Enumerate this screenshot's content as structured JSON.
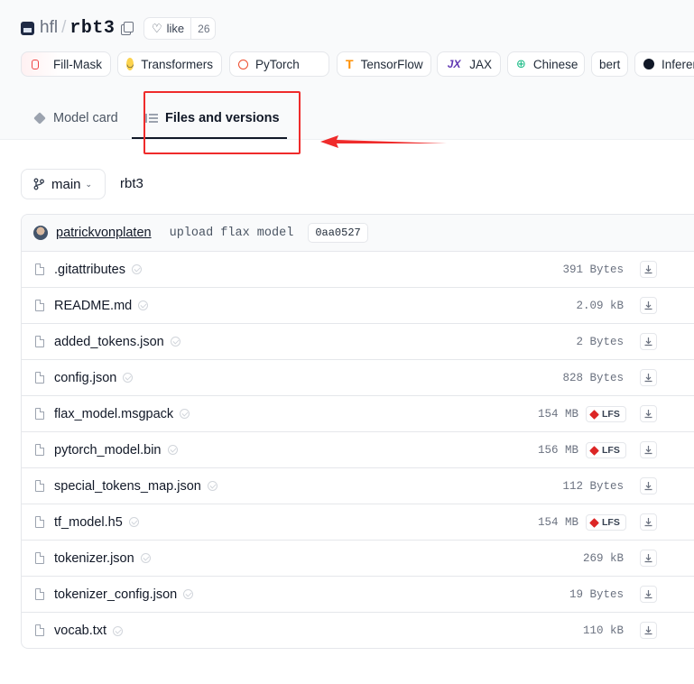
{
  "repo": {
    "org": "hfl",
    "name": "rbt3",
    "like_label": "like",
    "like_count": "26"
  },
  "tags": [
    {
      "label": "Fill-Mask",
      "icon": "fill-mask-icon"
    },
    {
      "label": "Transformers",
      "icon": "hugging-face-icon"
    },
    {
      "label": "PyTorch",
      "icon": "pytorch-icon"
    },
    {
      "label": "TensorFlow",
      "icon": "tensorflow-icon"
    },
    {
      "label": "JAX",
      "icon": "jax-icon"
    },
    {
      "label": "Chinese",
      "icon": "globe-icon"
    },
    {
      "label": "bert",
      "icon": ""
    },
    {
      "label": "Inference",
      "icon": "inference-icon"
    }
  ],
  "tabs": {
    "model_card": "Model card",
    "files": "Files and versions"
  },
  "branch": {
    "label": "main",
    "path": "rbt3"
  },
  "commit": {
    "author": "patrickvonplaten",
    "message": "upload flax model",
    "hash": "0aa0527"
  },
  "files": [
    {
      "name": ".gitattributes",
      "size": "391 Bytes",
      "lfs": false
    },
    {
      "name": "README.md",
      "size": "2.09 kB",
      "lfs": false
    },
    {
      "name": "added_tokens.json",
      "size": "2 Bytes",
      "lfs": false
    },
    {
      "name": "config.json",
      "size": "828 Bytes",
      "lfs": false
    },
    {
      "name": "flax_model.msgpack",
      "size": "154 MB",
      "lfs": true
    },
    {
      "name": "pytorch_model.bin",
      "size": "156 MB",
      "lfs": true
    },
    {
      "name": "special_tokens_map.json",
      "size": "112 Bytes",
      "lfs": false
    },
    {
      "name": "tf_model.h5",
      "size": "154 MB",
      "lfs": true
    },
    {
      "name": "tokenizer.json",
      "size": "269 kB",
      "lfs": false
    },
    {
      "name": "tokenizer_config.json",
      "size": "19 Bytes",
      "lfs": false
    },
    {
      "name": "vocab.txt",
      "size": "110 kB",
      "lfs": false
    }
  ],
  "lfs_label": "LFS",
  "colors": {
    "annotation": "#ef2b2b",
    "lfs": "#dc2626"
  }
}
